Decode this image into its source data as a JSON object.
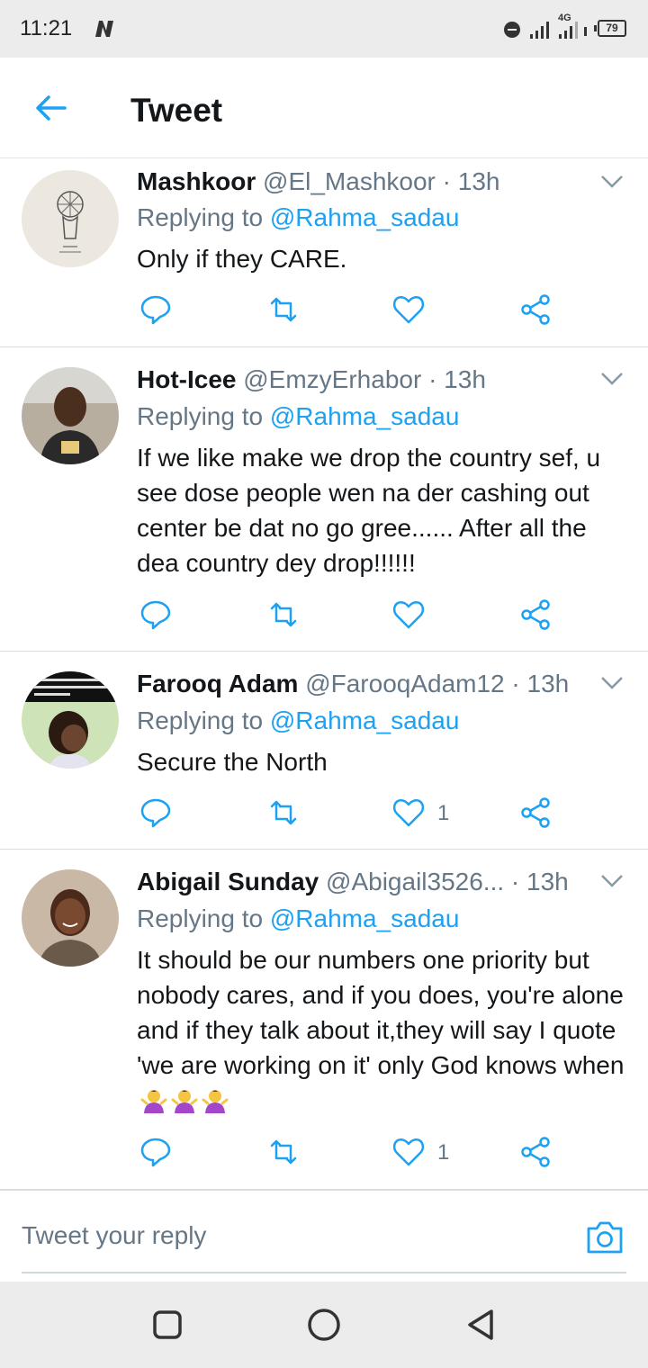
{
  "status_bar": {
    "time": "11:21",
    "network": "4G",
    "battery": "79"
  },
  "header": {
    "title": "Tweet"
  },
  "tweets": [
    {
      "name": "Mashkoor",
      "handle": "@El_Mashkoor",
      "time": " · 13h",
      "replying_prefix": "Replying to ",
      "replying_to": "@Rahma_sadau",
      "text": "Only if they CARE.",
      "likes": ""
    },
    {
      "name": "Hot-Icee",
      "handle": "@EmzyErhabor",
      "time": " · 13h",
      "replying_prefix": "Replying to ",
      "replying_to": "@Rahma_sadau",
      "text": "If we like make we  drop the country sef, u see dose people wen na der cashing out center be dat no go gree...... After all the dea country dey drop!!!!!!",
      "likes": ""
    },
    {
      "name": "Farooq Adam",
      "handle": "@FarooqAdam12",
      "time": " · 13h",
      "replying_prefix": "Replying to ",
      "replying_to": "@Rahma_sadau",
      "text": "Secure the North",
      "likes": "1"
    },
    {
      "name": "Abigail Sunday",
      "handle": "@Abigail3526...",
      "time": " · 13h",
      "replying_prefix": "Replying to ",
      "replying_to": "@Rahma_sadau",
      "text": "It should be our numbers one priority but nobody cares, and if you does, you're alone and if they talk about it,they will say I quote 'we are working on it' only God knows when",
      "likes": "1"
    }
  ],
  "reply": {
    "placeholder": "Tweet your reply"
  },
  "colors": {
    "accent": "#1da1f2",
    "secondary_text": "#657786",
    "primary_text": "#14171a"
  },
  "icons": {
    "reply": "reply-icon",
    "retweet": "retweet-icon",
    "like": "heart-icon",
    "share": "share-icon",
    "back": "back-arrow-icon",
    "camera": "camera-icon"
  }
}
